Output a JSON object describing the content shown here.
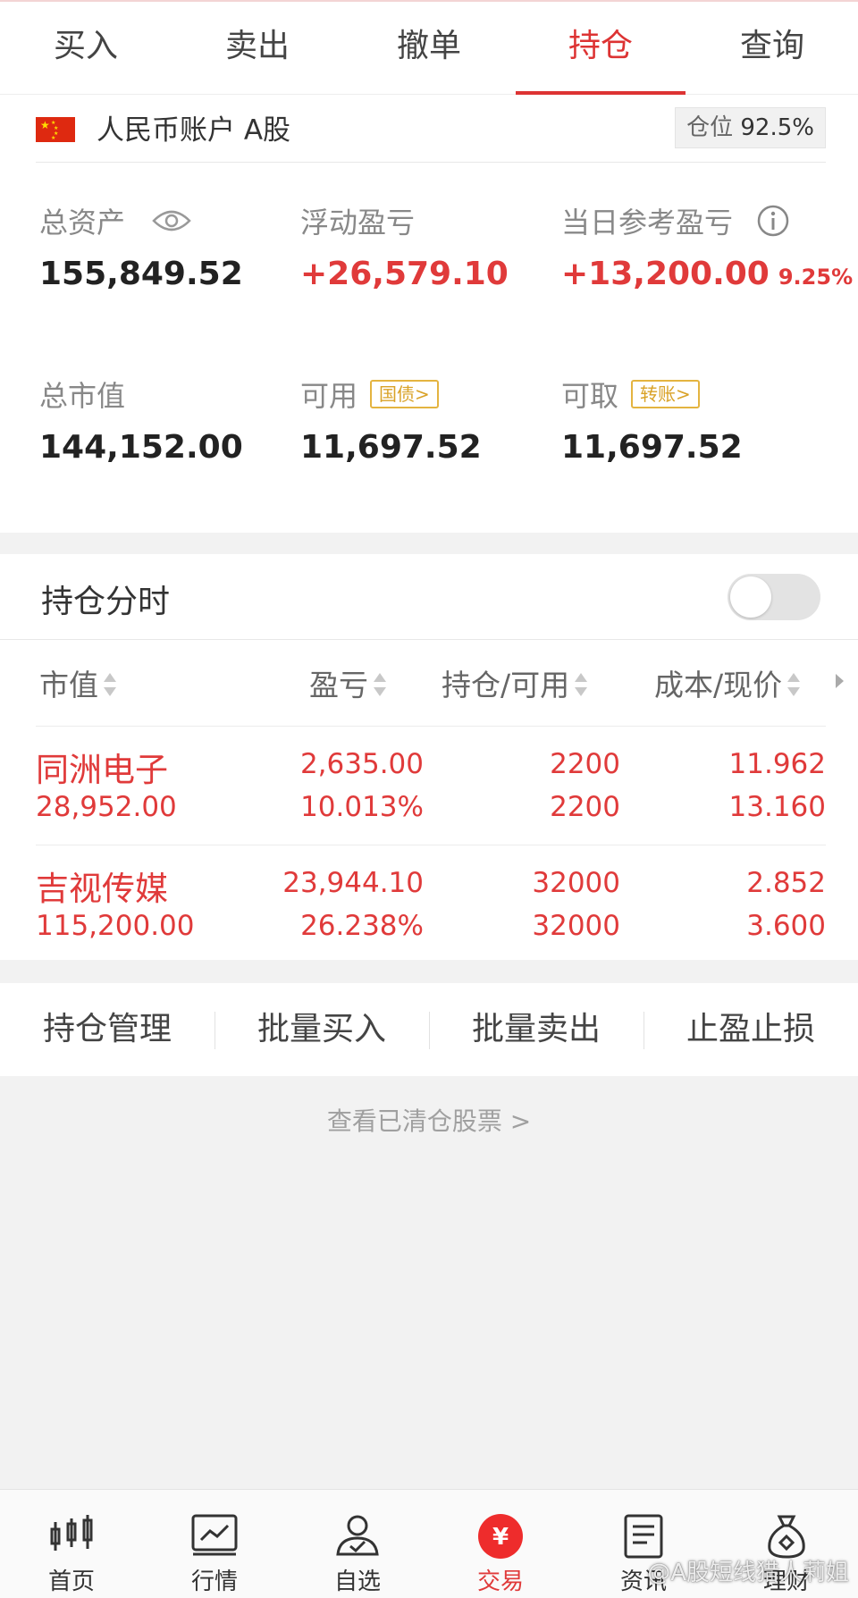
{
  "tabs": [
    {
      "label": "买入",
      "active": false
    },
    {
      "label": "卖出",
      "active": false
    },
    {
      "label": "撤单",
      "active": false
    },
    {
      "label": "持仓",
      "active": true
    },
    {
      "label": "查询",
      "active": false
    }
  ],
  "account": {
    "name": "人民币账户 A股",
    "position_label": "仓位",
    "position_value": "92.5%",
    "total_assets_label": "总资产",
    "total_assets": "155,849.52",
    "floating_pl_label": "浮动盈亏",
    "floating_pl": "+26,579.10",
    "daily_pl_label": "当日参考盈亏",
    "daily_pl": "+13,200.00",
    "daily_pl_pct": "9.25%",
    "market_value_label": "总市值",
    "market_value": "144,152.00",
    "available_label": "可用",
    "available_tag": "国债>",
    "available": "11,697.52",
    "withdrawable_label": "可取",
    "withdrawable_tag": "转账>",
    "withdrawable": "11,697.52"
  },
  "holdings": {
    "title": "持仓分时",
    "toggle_on": false,
    "columns": [
      "市值",
      "盈亏",
      "持仓/可用",
      "成本/现价"
    ],
    "rows": [
      {
        "name": "同洲电子",
        "market_value": "28,952.00",
        "pl": "2,635.00",
        "pl_pct": "10.013%",
        "position": "2200",
        "available": "2200",
        "cost": "11.962",
        "price": "13.160"
      },
      {
        "name": "吉视传媒",
        "market_value": "115,200.00",
        "pl": "23,944.10",
        "pl_pct": "26.238%",
        "position": "32000",
        "available": "32000",
        "cost": "2.852",
        "price": "3.600"
      }
    ]
  },
  "actions": [
    "持仓管理",
    "批量买入",
    "批量卖出",
    "止盈止损"
  ],
  "view_cleared": "查看已清仓股票 >",
  "bottom_nav": [
    {
      "label": "首页",
      "icon": "candlestick-icon"
    },
    {
      "label": "行情",
      "icon": "chart-line-icon"
    },
    {
      "label": "自选",
      "icon": "user-check-icon"
    },
    {
      "label": "交易",
      "icon": "yuan-circle-icon",
      "active": true
    },
    {
      "label": "资讯",
      "icon": "document-icon"
    },
    {
      "label": "理财",
      "icon": "money-bag-icon"
    }
  ],
  "watermark": "@A股短线猎人莉姐",
  "colors": {
    "accent": "#e03a3a",
    "tag": "#d9a227",
    "background": "#f2f2f2"
  }
}
